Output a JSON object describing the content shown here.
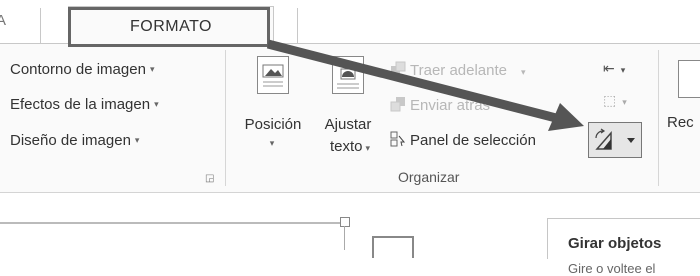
{
  "tabs": {
    "left_partial": "A",
    "active": "FORMATO"
  },
  "ajustar_imagen": {
    "items": [
      {
        "label": "Contorno de imagen"
      },
      {
        "label": "Efectos de la imagen"
      },
      {
        "label": "Diseño de imagen"
      }
    ],
    "dropdown_glyph": "▾"
  },
  "organizar": {
    "group_label": "Organizar",
    "posicion": {
      "label": "Posición",
      "arrow": "▾"
    },
    "ajustar_texto": {
      "label_line1": "Ajustar",
      "label_line2": "texto"
    },
    "traer_adelante": "Traer adelante",
    "enviar_atras": "Enviar atrás",
    "panel_seleccion": "Panel de selección"
  },
  "tamano": {
    "recortar_partial": "Rec"
  },
  "tooltip": {
    "title": "Girar objetos",
    "body_partial": "Gire o voltee el"
  },
  "colors": {
    "callout_border": "#666666",
    "arrow": "#555555",
    "ribbon_bg": "#fafafa"
  }
}
